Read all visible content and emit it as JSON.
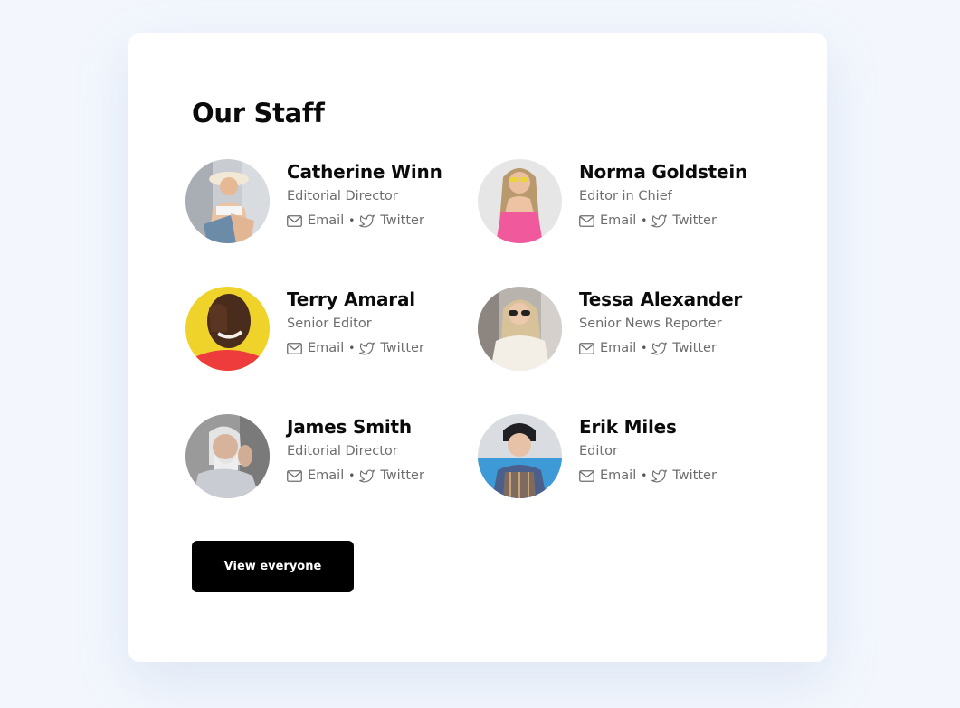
{
  "page_title": "Our Staff",
  "link_labels": {
    "email": "Email",
    "separator": "•",
    "twitter": "Twitter"
  },
  "staff": [
    {
      "name": "Catherine Winn",
      "role": "Editorial Director"
    },
    {
      "name": "Norma Goldstein",
      "role": "Editor in Chief"
    },
    {
      "name": "Terry Amaral",
      "role": "Senior Editor"
    },
    {
      "name": "Tessa Alexander",
      "role": "Senior News Reporter"
    },
    {
      "name": "James Smith",
      "role": "Editorial Director"
    },
    {
      "name": "Erik Miles",
      "role": "Editor"
    }
  ],
  "cta": {
    "label": "View everyone"
  },
  "colors": {
    "background": "#f3f7fd",
    "card": "#ffffff",
    "heading": "#0b0b0b",
    "muted_text": "#6d6d6d",
    "button": "#000000"
  }
}
